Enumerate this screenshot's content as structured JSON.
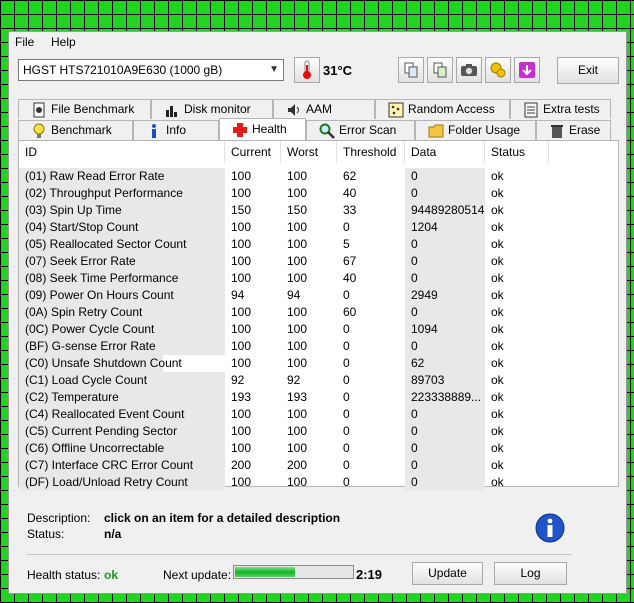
{
  "menu": {
    "file": "File",
    "help": "Help"
  },
  "drive": {
    "selected": "HGST HTS721010A9E630 (1000 gB)"
  },
  "temperature": "31°C",
  "exit_label": "Exit",
  "tabs_row1": [
    "File Benchmark",
    "Disk monitor",
    "AAM",
    "Random Access",
    "Extra tests"
  ],
  "tabs_row2": [
    "Benchmark",
    "Info",
    "Health",
    "Error Scan",
    "Folder Usage",
    "Erase"
  ],
  "table": {
    "headers": [
      "ID",
      "Current",
      "Worst",
      "Threshold",
      "Data",
      "Status"
    ],
    "rows": [
      [
        "(01) Raw Read Error Rate",
        "100",
        "100",
        "62",
        "0",
        "ok"
      ],
      [
        "(02) Throughput Performance",
        "100",
        "100",
        "40",
        "0",
        "ok"
      ],
      [
        "(03) Spin Up Time",
        "150",
        "150",
        "33",
        "94489280514",
        "ok"
      ],
      [
        "(04) Start/Stop Count",
        "100",
        "100",
        "0",
        "1204",
        "ok"
      ],
      [
        "(05) Reallocated Sector Count",
        "100",
        "100",
        "5",
        "0",
        "ok"
      ],
      [
        "(07) Seek Error Rate",
        "100",
        "100",
        "67",
        "0",
        "ok"
      ],
      [
        "(08) Seek Time Performance",
        "100",
        "100",
        "40",
        "0",
        "ok"
      ],
      [
        "(09) Power On Hours Count",
        "94",
        "94",
        "0",
        "2949",
        "ok"
      ],
      [
        "(0A) Spin Retry Count",
        "100",
        "100",
        "60",
        "0",
        "ok"
      ],
      [
        "(0C) Power Cycle Count",
        "100",
        "100",
        "0",
        "1094",
        "ok"
      ],
      [
        "(BF) G-sense Error Rate",
        "100",
        "100",
        "0",
        "0",
        "ok"
      ],
      [
        "(C0) Unsafe Shutdown Count",
        "100",
        "100",
        "0",
        "62",
        "ok"
      ],
      [
        "(C1) Load Cycle Count",
        "92",
        "92",
        "0",
        "89703",
        "ok"
      ],
      [
        "(C2) Temperature",
        "193",
        "193",
        "0",
        "223338889...",
        "ok"
      ],
      [
        "(C4) Reallocated Event Count",
        "100",
        "100",
        "0",
        "0",
        "ok"
      ],
      [
        "(C5) Current Pending Sector",
        "100",
        "100",
        "0",
        "0",
        "ok"
      ],
      [
        "(C6) Offline Uncorrectable",
        "100",
        "100",
        "0",
        "0",
        "ok"
      ],
      [
        "(C7) Interface CRC Error Count",
        "200",
        "200",
        "0",
        "0",
        "ok"
      ],
      [
        "(DF) Load/Unload Retry Count",
        "100",
        "100",
        "0",
        "0",
        "ok"
      ]
    ]
  },
  "description": {
    "label": "Description:",
    "value": "click on an item for a detailed description",
    "status_label": "Status:",
    "status_value": "n/a"
  },
  "footer": {
    "health_label": "Health status:",
    "health_value": "ok",
    "next_update_label": "Next update:",
    "progress_fraction": 0.5,
    "time": "2:19",
    "update_button": "Update",
    "log_button": "Log"
  },
  "colors": {
    "health_ok": "#1a9a1a",
    "progress": "#17b32a",
    "background_grid": "#22d322"
  }
}
